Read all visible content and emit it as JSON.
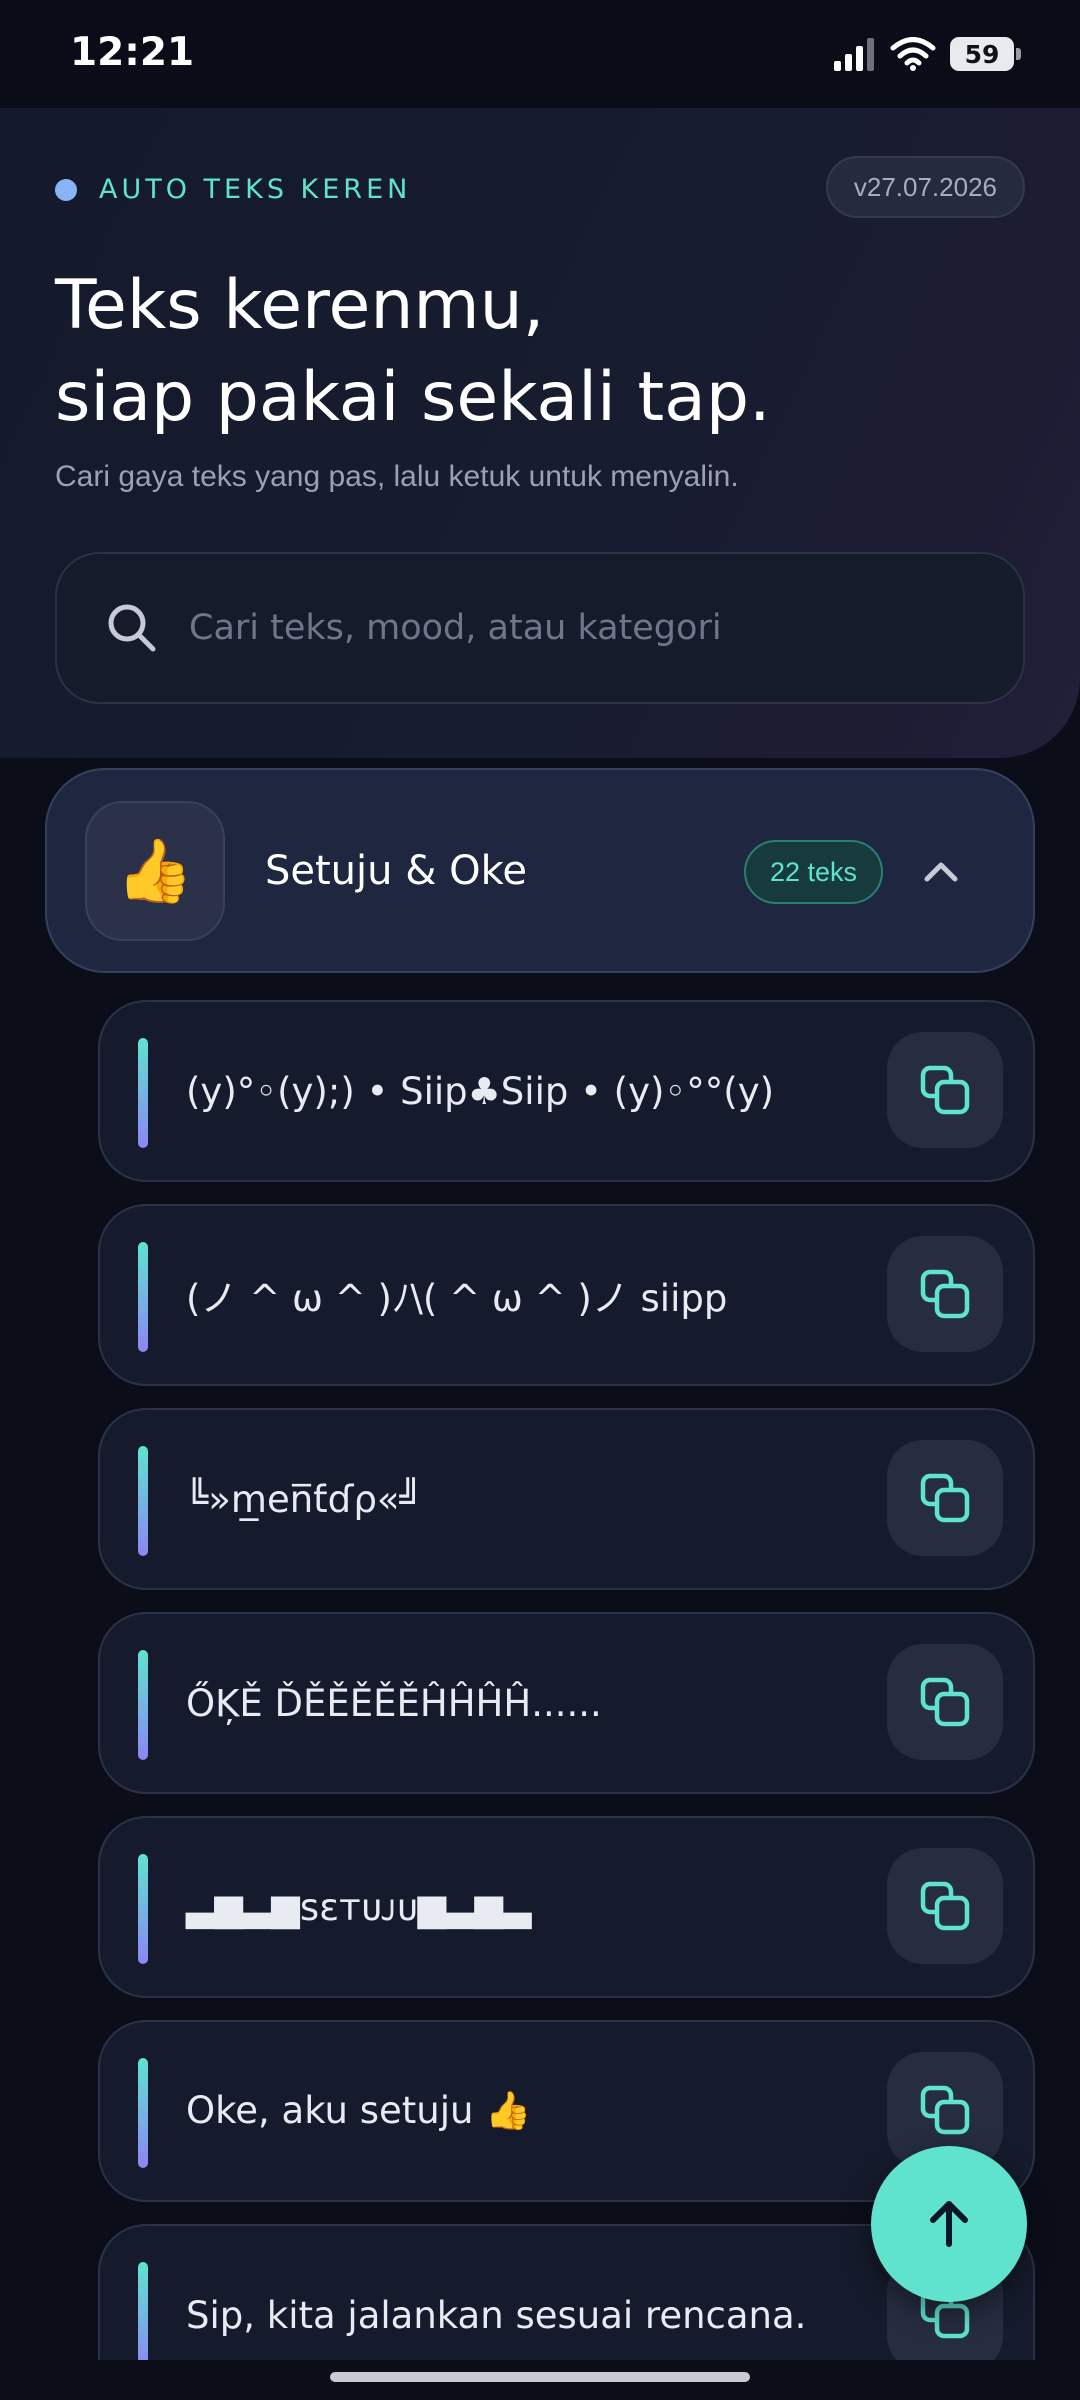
{
  "status_bar": {
    "time": "12:21",
    "battery": "59"
  },
  "hero": {
    "brand": "AUTO TEKS KEREN",
    "version": "v27.07.2026",
    "title_line1": "Teks kerenmu,",
    "title_line2": "siap pakai sekali tap.",
    "subtitle": "Cari gaya teks yang pas, lalu ketuk untuk menyalin."
  },
  "search": {
    "placeholder": "Cari teks, mood, atau kategori",
    "value": ""
  },
  "category": {
    "icon": "👍",
    "title": "Setuju & Oke",
    "count": "22 teks",
    "expanded": true
  },
  "items": [
    {
      "text": "(y)°◦(y);) • Siip♣Siip • (y)◦°°(y)"
    },
    {
      "text": "(ノ ^ ω ^ )ﾉ\\( ^ ω ^  )ノ siipp"
    },
    {
      "text": " ╚»m̲en̅ƭɗρ«╝"
    },
    {
      "text": "ŐĶĚ ĎĚĚĚĚĚĤĤĤĤ......"
    },
    {
      "text": "▃▆▃▆sɛᴛᴜᴊᴜ▆▃▆▃"
    },
    {
      "text": "Oke, aku setuju 👍"
    },
    {
      "text": "Sip, kita jalankan sesuai rencana."
    }
  ],
  "colors": {
    "accent_teal": "#5fe3cf",
    "accent_violet": "#8b86f5",
    "background": "#0b0e19"
  },
  "icons": {
    "search": "search-icon",
    "chevron": "chevron-up-icon",
    "copy": "copy-icon",
    "scroll_top": "arrow-up-icon"
  }
}
